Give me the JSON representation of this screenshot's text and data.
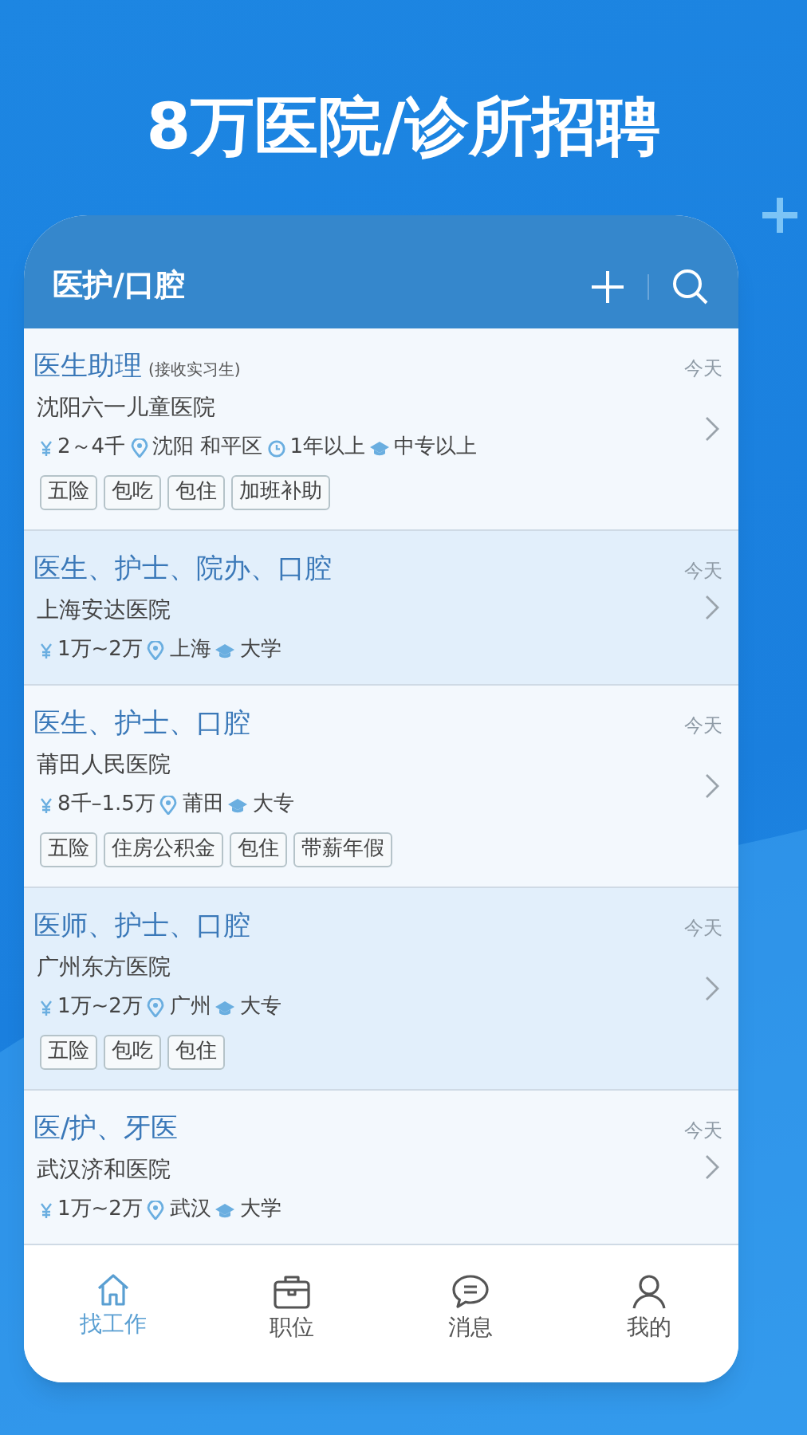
{
  "headline": "8万医院/诊所招聘",
  "header": {
    "title": "医护/口腔"
  },
  "jobs": [
    {
      "title": "医生助理",
      "note": "(接收实习生)",
      "hospital": "沈阳六一儿童医院",
      "date": "今天",
      "highlighted": false,
      "meta": [
        {
          "kind": "salary",
          "text": "2～4千"
        },
        {
          "kind": "location",
          "text": "沈阳 和平区"
        },
        {
          "kind": "experience",
          "text": "1年以上"
        },
        {
          "kind": "education",
          "text": "中专以上"
        }
      ],
      "tags": [
        "五险",
        "包吃",
        "包住",
        "加班补助"
      ]
    },
    {
      "title": "医生、护士、院办、口腔",
      "hospital": "上海安达医院",
      "date": "今天",
      "highlighted": true,
      "meta": [
        {
          "kind": "salary",
          "text": "1万~2万"
        },
        {
          "kind": "location",
          "text": "上海"
        },
        {
          "kind": "education",
          "text": "大学"
        }
      ]
    },
    {
      "title": "医生、护士、口腔",
      "hospital": "莆田人民医院",
      "date": "今天",
      "highlighted": false,
      "meta": [
        {
          "kind": "salary",
          "text": "8千–1.5万"
        },
        {
          "kind": "location",
          "text": "莆田"
        },
        {
          "kind": "education",
          "text": "大专"
        }
      ],
      "tags": [
        "五险",
        "住房公积金",
        "包住",
        "带薪年假"
      ]
    },
    {
      "title": "医师、护士、口腔",
      "hospital": "广州东方医院",
      "date": "今天",
      "highlighted": true,
      "meta": [
        {
          "kind": "salary",
          "text": "1万~2万"
        },
        {
          "kind": "location",
          "text": "广州"
        },
        {
          "kind": "education",
          "text": "大专"
        }
      ],
      "tags": [
        "五险",
        "包吃",
        "包住"
      ]
    },
    {
      "title": "医/护、牙医",
      "hospital": "武汉济和医院",
      "date": "今天",
      "highlighted": false,
      "meta": [
        {
          "kind": "salary",
          "text": "1万~2万"
        },
        {
          "kind": "location",
          "text": "武汉"
        },
        {
          "kind": "education",
          "text": "大学"
        }
      ]
    }
  ],
  "tabs": [
    {
      "kind": "home",
      "label": "找工作",
      "selected": true
    },
    {
      "kind": "briefcase",
      "label": "职位",
      "selected": false
    },
    {
      "kind": "chat",
      "label": "消息",
      "selected": false
    },
    {
      "kind": "user",
      "label": "我的",
      "selected": false
    }
  ]
}
